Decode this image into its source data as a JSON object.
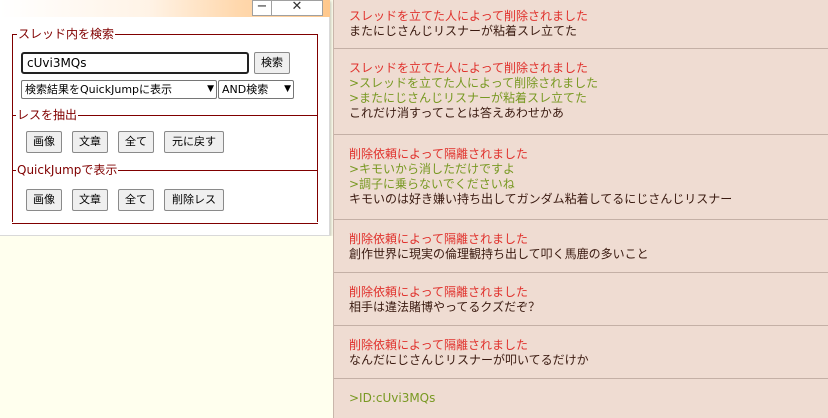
{
  "window": {
    "minimize_glyph": "−",
    "close_glyph": "✕"
  },
  "search": {
    "section_title": "スレッド内を検索",
    "query_value": "cUvi3MQs",
    "search_button": "検索",
    "display_mode_selected": "検索結果をQuickJumpに表示",
    "logic_selected": "AND検索"
  },
  "extract": {
    "section_title": "レスを抽出",
    "buttons": [
      "画像",
      "文章",
      "全て",
      "元に戻す"
    ]
  },
  "quickjump": {
    "section_title": "QuickJumpで表示",
    "buttons": [
      "画像",
      "文章",
      "全て",
      "削除レス"
    ]
  },
  "posts": [
    {
      "lines": [
        {
          "text": "スレッドを立てた人によって削除されました",
          "style": "red"
        },
        {
          "text": "またにじさんじリスナーが粘着スレ立てた",
          "style": "dark"
        }
      ]
    },
    {
      "lines": [
        {
          "text": "スレッドを立てた人によって削除されました",
          "style": "red"
        },
        {
          "text": ">スレッドを立てた人によって削除されました",
          "style": "green"
        },
        {
          "text": ">またにじさんじリスナーが粘着スレ立てた",
          "style": "green"
        },
        {
          "text": "これだけ消すってことは答えあわせかあ",
          "style": "dark"
        }
      ]
    },
    {
      "lines": [
        {
          "text": "削除依頼によって隔離されました",
          "style": "red"
        },
        {
          "text": ">キモいから消しただけですよ",
          "style": "green"
        },
        {
          "text": ">調子に乗らないでくださいね",
          "style": "green"
        },
        {
          "text": "キモいのは好き嫌い持ち出してガンダム粘着してるにじさんじリスナー",
          "style": "dark"
        }
      ]
    },
    {
      "lines": [
        {
          "text": "削除依頼によって隔離されました",
          "style": "red"
        },
        {
          "text": "創作世界に現実の倫理観持ち出して叩く馬鹿の多いこと",
          "style": "dark"
        }
      ]
    },
    {
      "lines": [
        {
          "text": "削除依頼によって隔離されました",
          "style": "red"
        },
        {
          "text": "相手は違法賭博やってるクズだぞ？",
          "style": "dark"
        }
      ]
    },
    {
      "lines": [
        {
          "text": "削除依頼によって隔離されました",
          "style": "red"
        },
        {
          "text": "なんだにじさんじリスナーが叩いてるだけか",
          "style": "dark"
        }
      ]
    },
    {
      "lines": [
        {
          "text": ">ID:cUvi3MQs",
          "style": "green"
        }
      ]
    }
  ]
}
